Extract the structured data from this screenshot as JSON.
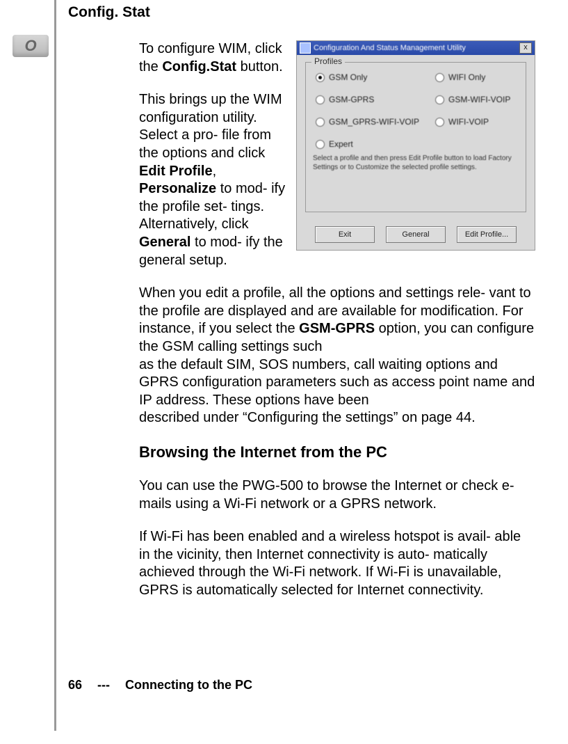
{
  "page": {
    "number": "66",
    "sep": "---",
    "section": "Connecting to the PC"
  },
  "heading": "Config. Stat",
  "para1_pre": "To configure WIM, click the ",
  "para1_b1": "Config.Stat",
  "para1_post": " button.",
  "para2_a": "This brings up the WIM configuration utility. Select a pro- file from the options and click ",
  "para2_b1": "Edit Profile",
  "para2_mid1": ", ",
  "para2_b2": "Personalize",
  "para2_mid2": " to mod- ify the profile set- tings. Alternatively, click ",
  "para2_b3": "General",
  "para2_post": " to mod- ify the general setup.",
  "para3_a": "When you edit a profile, all the options and settings rele- vant to the profile are displayed and are available for modification. For instance, if you select the ",
  "para3_b1": "GSM-GPRS",
  "para3_b": " option, you can configure the GSM calling settings such",
  "para3_c": "as the default SIM, SOS numbers, call waiting options and GPRS configuration parameters such as access point name and IP address. These options have been",
  "para3_d": "described under “Configuring the settings” on page 44.",
  "subhead": "Browsing the Internet from the PC",
  "para4": "You can use the PWG-500 to browse the Internet or check e-mails using a Wi-Fi network or a GPRS network.",
  "para5": "If Wi-Fi has been enabled and a wireless hotspot is avail- able in the vicinity, then Internet connectivity is auto- matically achieved through the Wi-Fi network. If Wi-Fi is unavailable, GPRS is automatically selected for Internet connectivity.",
  "dialog": {
    "title": "Configuration And Status Management Utility",
    "group": "Profiles",
    "radios": {
      "r1": "GSM Only",
      "r2": "WIFI Only",
      "r3": "GSM-GPRS",
      "r4": "GSM-WIFI-VOIP",
      "r5": "GSM_GPRS-WIFI-VOIP",
      "r6": "WIFI-VOIP",
      "r7": "Expert"
    },
    "hint": "Select a profile and then press Edit Profile button to load Factory Settings or to Customize the selected profile settings.",
    "buttons": {
      "exit": "Exit",
      "general": "General",
      "edit": "Edit Profile..."
    }
  }
}
